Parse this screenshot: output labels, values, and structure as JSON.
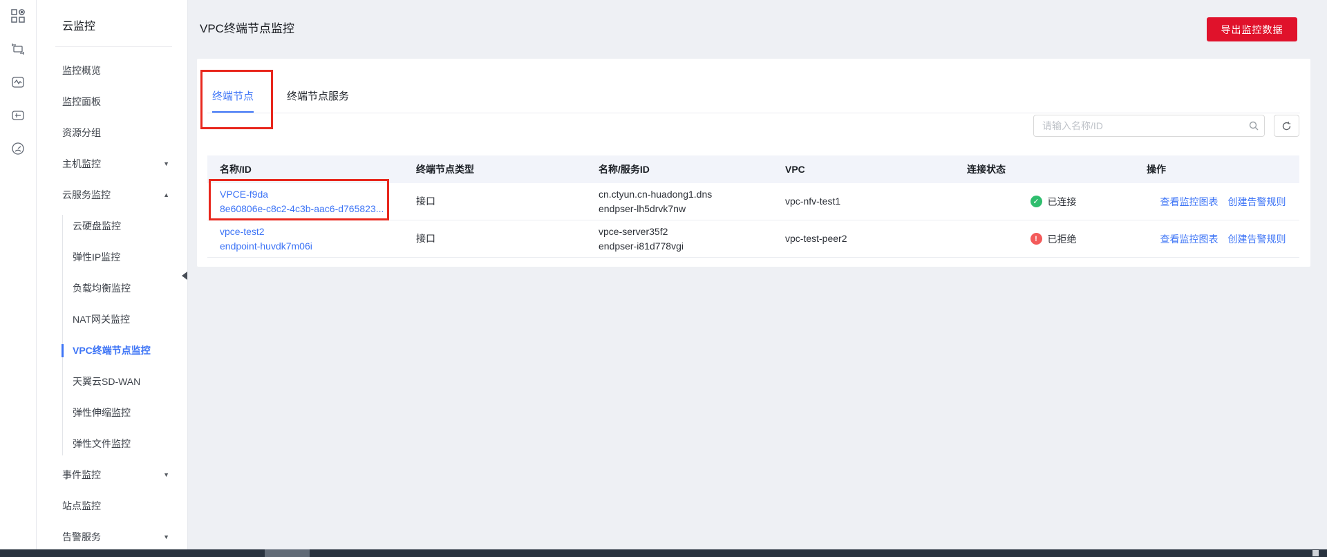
{
  "icon_rail": {
    "icons": [
      {
        "name": "console-apps-icon"
      },
      {
        "name": "vpc-network-icon"
      },
      {
        "name": "cloud-monitor-icon"
      },
      {
        "name": "host-monitor-icon"
      },
      {
        "name": "dashboard-gauge-icon"
      }
    ]
  },
  "sidebar": {
    "title": "云监控",
    "items": [
      {
        "label": "监控概览"
      },
      {
        "label": "监控面板"
      },
      {
        "label": "资源分组"
      },
      {
        "label": "主机监控",
        "caret": "down"
      },
      {
        "label": "云服务监控",
        "caret": "up"
      },
      {
        "label": "云硬盘监控",
        "sub": true
      },
      {
        "label": "弹性IP监控",
        "sub": true
      },
      {
        "label": "负载均衡监控",
        "sub": true
      },
      {
        "label": "NAT网关监控",
        "sub": true
      },
      {
        "label": "VPC终端节点监控",
        "sub": true,
        "active": true
      },
      {
        "label": "天翼云SD-WAN",
        "sub": true
      },
      {
        "label": "弹性伸缩监控",
        "sub": true
      },
      {
        "label": "弹性文件监控",
        "sub": true
      },
      {
        "label": "事件监控",
        "caret": "down"
      },
      {
        "label": "站点监控"
      },
      {
        "label": "告警服务",
        "caret": "down"
      }
    ]
  },
  "page": {
    "title": "VPC终端节点监控",
    "export_button": "导出监控数据",
    "tabs": [
      {
        "label": "终端节点",
        "active": true
      },
      {
        "label": "终端节点服务",
        "active": false
      }
    ],
    "search": {
      "placeholder": "请输入名称/ID"
    }
  },
  "table": {
    "columns": [
      "名称/ID",
      "终端节点类型",
      "名称/服务ID",
      "VPC",
      "连接状态",
      "操作"
    ],
    "rows": [
      {
        "name": "VPCE-f9da",
        "id": "8e60806e-c8c2-4c3b-aac6-d765823...",
        "type": "接口",
        "service_name": "cn.ctyun.cn-huadong1.dns",
        "service_id": "endpser-lh5drvk7nw",
        "vpc": "vpc-nfv-test1",
        "status": "已连接",
        "status_type": "connected",
        "actions": [
          "查看监控图表",
          "创建告警规则"
        ]
      },
      {
        "name": "vpce-test2",
        "id": "endpoint-huvdk7m06i",
        "type": "接口",
        "service_name": "vpce-server35f2",
        "service_id": "endpser-i81d778vgi",
        "vpc": "vpc-test-peer2",
        "status": "已拒绝",
        "status_type": "rejected",
        "actions": [
          "查看监控图表",
          "创建告警规则"
        ]
      }
    ]
  },
  "glyphs": {
    "caret_down": "▼",
    "caret_up": "▲",
    "check": "✓",
    "exclaim": "!"
  },
  "colors": {
    "brand_red": "#e0122b",
    "link_blue": "#3d74f6",
    "green": "#2fbe6e",
    "status_red": "#f35a5a",
    "annotation_red": "#e8271d"
  }
}
